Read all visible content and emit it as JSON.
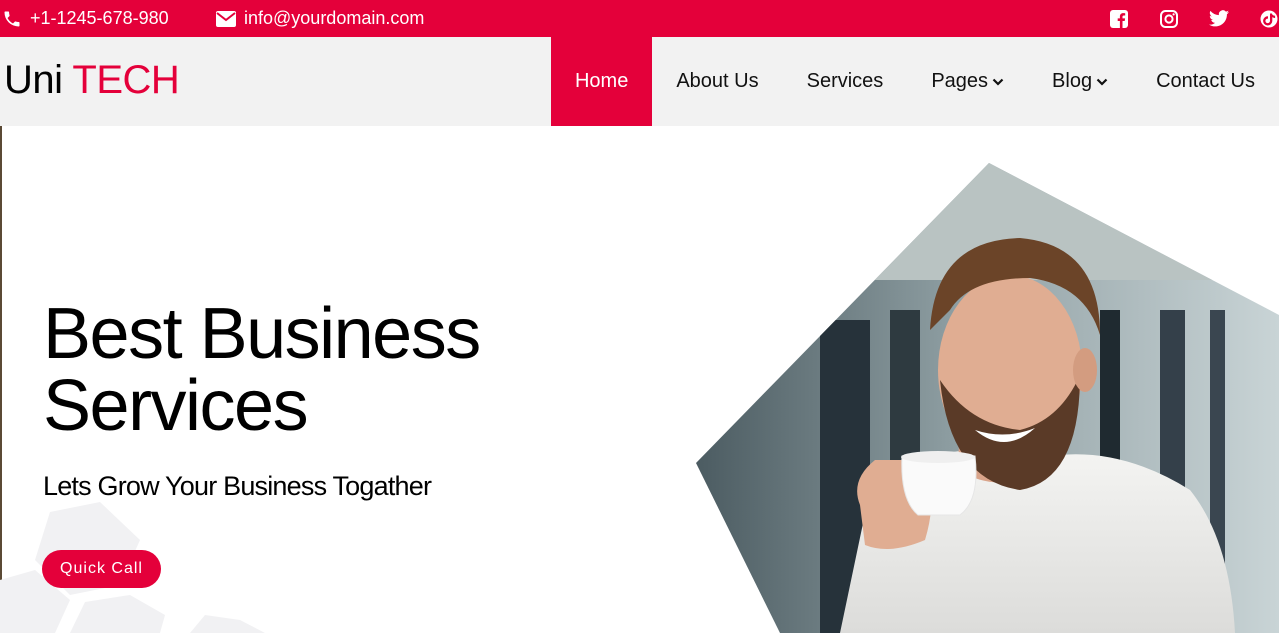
{
  "topbar": {
    "phone": "+1-1245-678-980",
    "email": "info@yourdomain.com",
    "social": [
      "facebook-icon",
      "instagram-icon",
      "twitter-icon",
      "tiktok-icon"
    ]
  },
  "logo": {
    "part1": "Uni",
    "part2": "TECH"
  },
  "nav": {
    "home": "Home",
    "about": "About Us",
    "services": "Services",
    "pages": "Pages",
    "blog": "Blog",
    "contact": "Contact Us"
  },
  "hero": {
    "title_line1": "Best Business",
    "title_line2": "Services",
    "subtitle": "Lets Grow Your Business Togather",
    "cta": "Quick Call"
  },
  "colors": {
    "accent": "#e4003a",
    "nav_bg": "#f2f2f2",
    "text": "#000000"
  }
}
